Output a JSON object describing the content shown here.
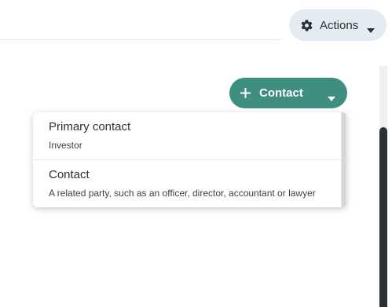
{
  "header": {
    "actions_label": "Actions",
    "actions_icon": "gear-icon",
    "actions_caret_icon": "caret-down-icon"
  },
  "contact_button": {
    "label": "Contact",
    "icon": "plus-icon",
    "caret_icon": "caret-down-icon",
    "color": "#3e8f80"
  },
  "dropdown": {
    "items": [
      {
        "title": "Primary contact",
        "description": "Investor"
      },
      {
        "title": "Contact",
        "description": "A related party, such as an officer, director, accountant or lawyer"
      }
    ]
  }
}
